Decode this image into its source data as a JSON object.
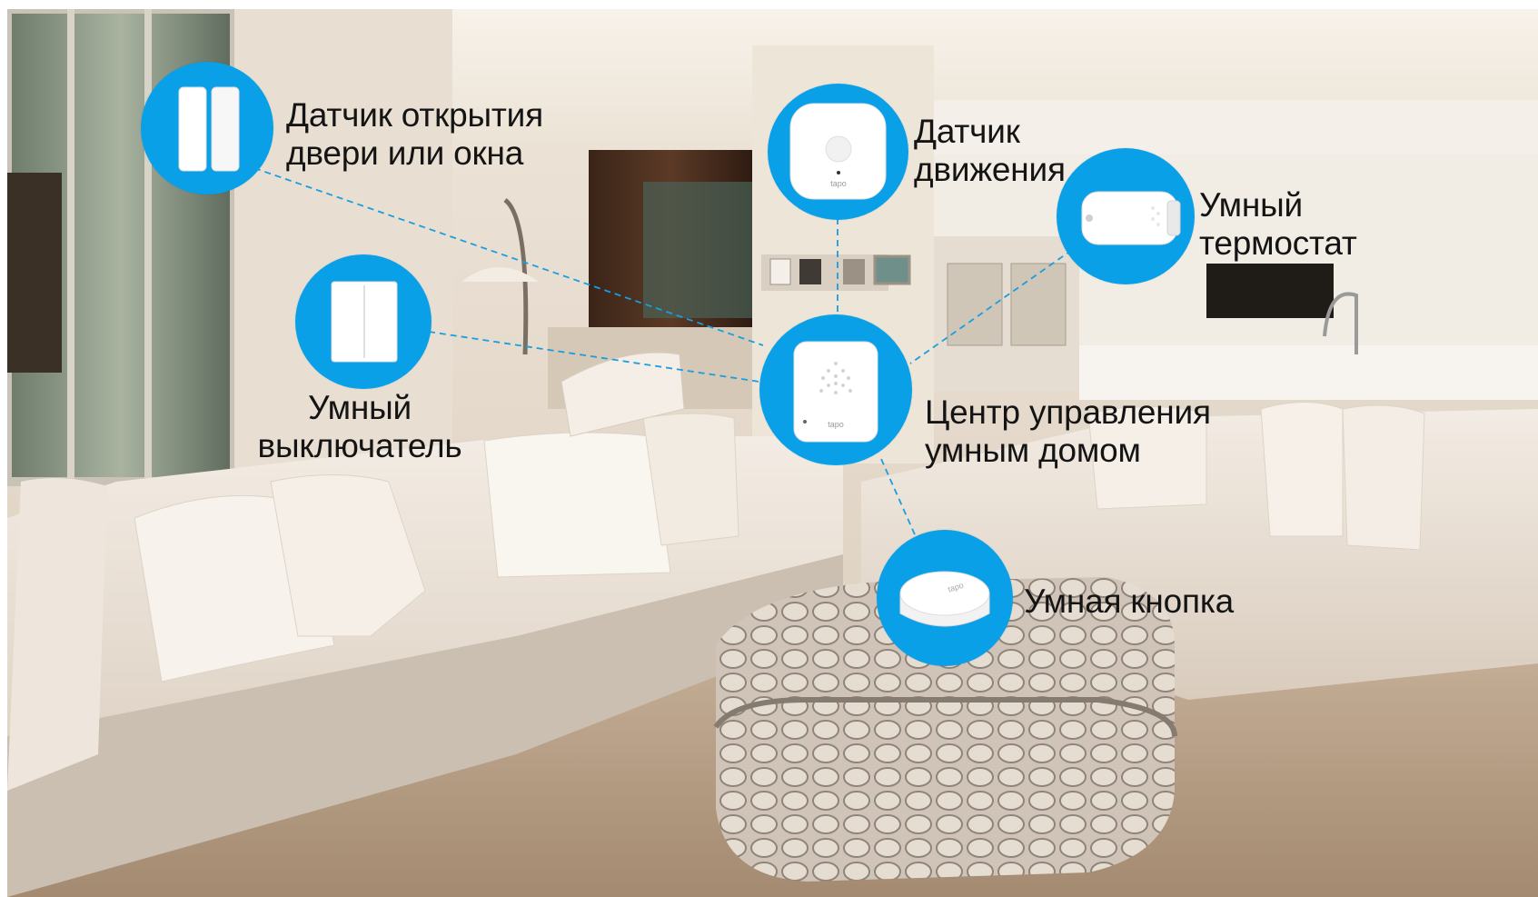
{
  "colors": {
    "accent": "#0aa0e8",
    "link_line": "#1a9ee0",
    "label_text": "#141414"
  },
  "devices": {
    "contact_sensor": {
      "icon": "contact-sensor-icon",
      "label_lines": [
        "Датчик открытия",
        "двери или окна"
      ]
    },
    "motion_sensor": {
      "icon": "motion-sensor-icon",
      "brand_mark": "tapo",
      "label_lines": [
        "Датчик",
        "движения"
      ]
    },
    "thermostat": {
      "icon": "thermostat-head-icon",
      "label_lines": [
        "Умный",
        "термостат"
      ]
    },
    "switch": {
      "icon": "wall-switch-icon",
      "label_lines": [
        "Умный",
        "выключатель"
      ]
    },
    "hub": {
      "icon": "smart-hub-icon",
      "brand_mark": "tapo",
      "label_lines": [
        "Центр управления",
        "умным домом"
      ]
    },
    "button": {
      "icon": "smart-button-icon",
      "brand_mark": "tapo",
      "label_lines": [
        "Умная кнопка"
      ]
    }
  }
}
